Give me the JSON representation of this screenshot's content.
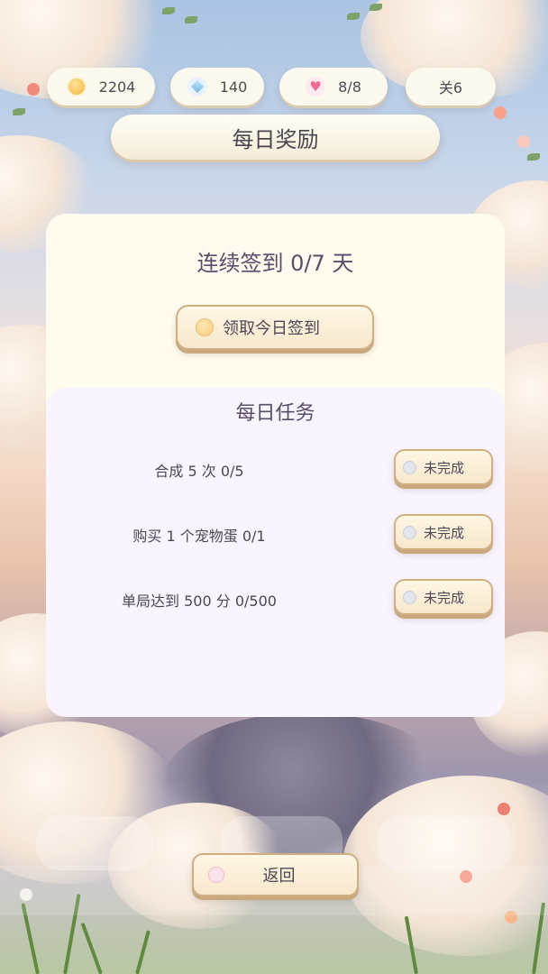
{
  "status_bar": {
    "coins": "2204",
    "gems": "140",
    "lives": "8/8",
    "level": "关6"
  },
  "title": "每日奖励",
  "signin": {
    "streak_text": "连续签到 0/7 天",
    "button_label": "领取今日签到"
  },
  "tasks": {
    "title": "每日任务",
    "items": [
      {
        "label": "合成 5 次  0/5",
        "status": "未完成"
      },
      {
        "label": "购买 1 个宠物蛋  0/1",
        "status": "未完成"
      },
      {
        "label": "单局达到 500 分  0/500",
        "status": "未完成"
      }
    ]
  },
  "back_button": "返回",
  "icons": {
    "coin": "coin-icon",
    "gem": "diamond-icon",
    "lives": "heart-icon"
  },
  "colors": {
    "panel_top": "#fffbee",
    "panel_bottom": "#f9f4fe",
    "button_border": "#cfae82",
    "text": "#4e4656"
  }
}
